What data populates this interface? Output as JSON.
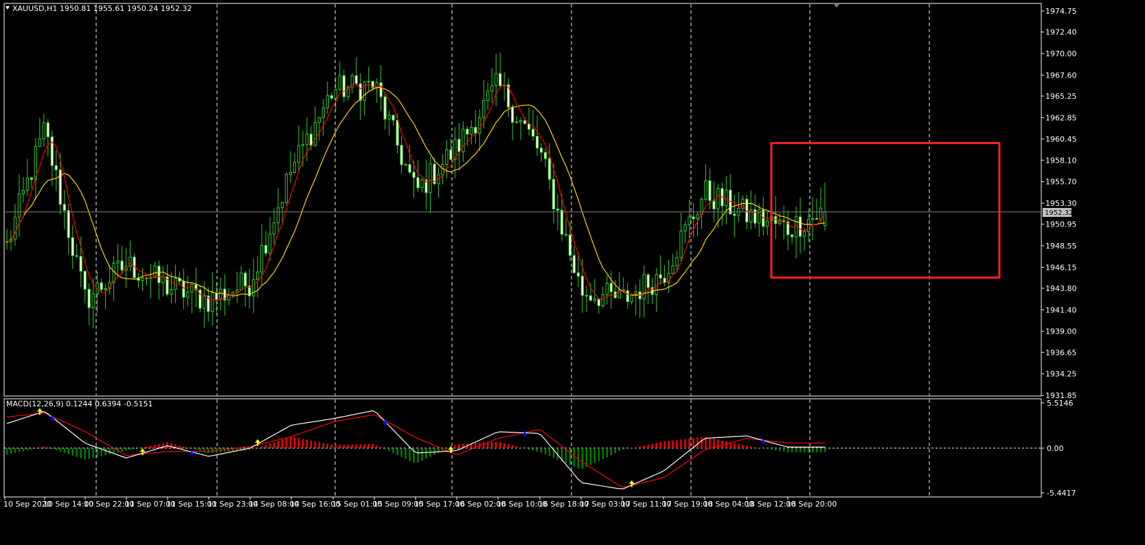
{
  "main": {
    "symbol_caption": "XAUUSD,H1  1950.81 1955.61 1950.24 1952.32",
    "current_price": "1952.32",
    "y_ticks": [
      "1974.75",
      "1972.40",
      "1970.00",
      "1967.60",
      "1965.25",
      "1962.85",
      "1960.45",
      "1958.10",
      "1955.70",
      "1953.30",
      "1950.95",
      "1948.55",
      "1946.15",
      "1943.80",
      "1941.40",
      "1939.00",
      "1936.65",
      "1934.25",
      "1931.85"
    ],
    "colors": {
      "candle": "#32CD32",
      "fast_ma": "#FF0000",
      "slow_ma": "#FFD700",
      "highlight_box": "#FF2020",
      "bid_line": "#808080",
      "background": "#000000"
    }
  },
  "macd_panel": {
    "caption": "MACD(12,26,9) 0.1244 0.6394 -0.5151",
    "y_ticks": [
      "5.5146",
      "0.00",
      "-5.4417"
    ],
    "colors": {
      "histogram_positive": "#FF0000",
      "histogram_negative": "#008000",
      "macd_line": "#FFFFFF",
      "signal_line": "#FF0000",
      "arrow_up": "#FFFF00",
      "arrow_down": "#0000FF"
    }
  },
  "x_ticks": [
    "10 Sep 2020",
    "10 Sep 14:00",
    "10 Sep 22:00",
    "11 Sep 07:00",
    "11 Sep 15:00",
    "11 Sep 23:00",
    "14 Sep 08:00",
    "14 Sep 16:00",
    "15 Sep 01:00",
    "15 Sep 09:00",
    "15 Sep 17:00",
    "16 Sep 02:00",
    "16 Sep 10:00",
    "16 Sep 18:00",
    "17 Sep 03:00",
    "17 Sep 11:00",
    "17 Sep 19:00",
    "18 Sep 04:00",
    "18 Sep 12:00",
    "18 Sep 20:00"
  ],
  "chart_data": {
    "type": "candlestick",
    "symbol": "XAUUSD",
    "timeframe": "H1",
    "last_bar": {
      "open": 1950.81,
      "high": 1955.61,
      "low": 1950.24,
      "close": 1952.32
    },
    "ylim": [
      1931.85,
      1974.75
    ],
    "close_path_points": [
      {
        "x": "10 Sep 2020",
        "close": 1948.5
      },
      {
        "x": "10 Sep 14:00",
        "close": 1961.5
      },
      {
        "x": "10 Sep 22:00",
        "close": 1942.5
      },
      {
        "x": "11 Sep 07:00",
        "close": 1946.5
      },
      {
        "x": "11 Sep 15:00",
        "close": 1944.0
      },
      {
        "x": "11 Sep 23:00",
        "close": 1942.5
      },
      {
        "x": "14 Sep 08:00",
        "close": 1944.5
      },
      {
        "x": "14 Sep 16:00",
        "close": 1957.0
      },
      {
        "x": "15 Sep 01:00",
        "close": 1966.0
      },
      {
        "x": "15 Sep 09:00",
        "close": 1966.5
      },
      {
        "x": "15 Sep 17:00",
        "close": 1954.5
      },
      {
        "x": "16 Sep 02:00",
        "close": 1959.5
      },
      {
        "x": "16 Sep 10:00",
        "close": 1966.5
      },
      {
        "x": "16 Sep 18:00",
        "close": 1959.0
      },
      {
        "x": "17 Sep 03:00",
        "close": 1943.5
      },
      {
        "x": "17 Sep 11:00",
        "close": 1942.5
      },
      {
        "x": "17 Sep 19:00",
        "close": 1945.5
      },
      {
        "x": "18 Sep 04:00",
        "close": 1954.5
      },
      {
        "x": "18 Sep 12:00",
        "close": 1952.0
      },
      {
        "x": "18 Sep 20:00",
        "close": 1950.5
      }
    ],
    "last_close": 1952.32,
    "highlight_box_price_range": [
      1945.0,
      1960.0
    ],
    "macd": {
      "params": [
        12,
        26,
        9
      ],
      "values": {
        "macd": 0.1244,
        "signal": 0.6394,
        "histogram": -0.5151
      },
      "ylim": [
        -5.4417,
        5.5146
      ],
      "path_points": [
        {
          "x": "10 Sep 2020",
          "macd": 3.0,
          "signal": 3.8
        },
        {
          "x": "10 Sep 14:00",
          "macd": 4.5,
          "signal": 4.3
        },
        {
          "x": "10 Sep 22:00",
          "macd": 0.6,
          "signal": 2.0
        },
        {
          "x": "11 Sep 07:00",
          "macd": -1.2,
          "signal": -0.9
        },
        {
          "x": "11 Sep 15:00",
          "macd": 0.3,
          "signal": -0.4
        },
        {
          "x": "11 Sep 23:00",
          "macd": -1.0,
          "signal": -0.4
        },
        {
          "x": "14 Sep 08:00",
          "macd": 0.0,
          "signal": 0.2
        },
        {
          "x": "14 Sep 16:00",
          "macd": 2.8,
          "signal": 1.4
        },
        {
          "x": "15 Sep 01:00",
          "macd": 3.6,
          "signal": 3.2
        },
        {
          "x": "15 Sep 09:00",
          "macd": 4.6,
          "signal": 4.1
        },
        {
          "x": "15 Sep 17:00",
          "macd": -0.6,
          "signal": 1.3
        },
        {
          "x": "16 Sep 02:00",
          "macd": -0.3,
          "signal": -0.8
        },
        {
          "x": "16 Sep 10:00",
          "macd": 2.0,
          "signal": 1.2
        },
        {
          "x": "16 Sep 18:00",
          "macd": 1.8,
          "signal": 2.3
        },
        {
          "x": "17 Sep 03:00",
          "macd": -4.2,
          "signal": -1.6
        },
        {
          "x": "17 Sep 11:00",
          "macd": -5.0,
          "signal": -4.8
        },
        {
          "x": "17 Sep 19:00",
          "macd": -2.8,
          "signal": -3.6
        },
        {
          "x": "18 Sep 04:00",
          "macd": 1.2,
          "signal": -0.2
        },
        {
          "x": "18 Sep 12:00",
          "macd": 1.5,
          "signal": 1.2
        },
        {
          "x": "18 Sep 20:00",
          "macd": 0.1244,
          "signal": 0.6394
        }
      ]
    }
  }
}
